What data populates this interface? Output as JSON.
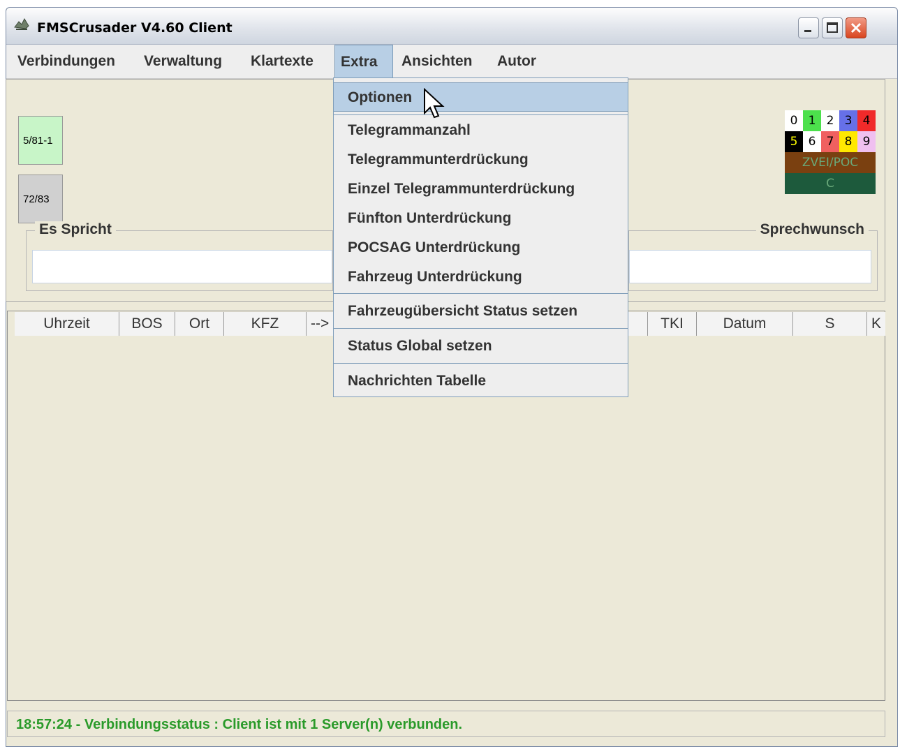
{
  "window": {
    "title": "FMSCrusader V4.60 Client"
  },
  "menubar": {
    "items": [
      {
        "label": "Verbindungen"
      },
      {
        "label": "Verwaltung"
      },
      {
        "label": "Klartexte"
      },
      {
        "label": "Extra"
      },
      {
        "label": "Ansichten"
      },
      {
        "label": "Autor"
      }
    ],
    "active": "Extra"
  },
  "units": [
    {
      "label": "5/81-1",
      "color": "#c8f5c8"
    },
    {
      "label": "72/83",
      "color": "#d0d0d0"
    }
  ],
  "status_legend": {
    "row1": [
      {
        "label": "0",
        "bg": "#ffffff",
        "fg": "#000000"
      },
      {
        "label": "1",
        "bg": "#4ce04c",
        "fg": "#000000"
      },
      {
        "label": "2",
        "bg": "#ffffff",
        "fg": "#000000"
      },
      {
        "label": "3",
        "bg": "#6670e8",
        "fg": "#000000"
      },
      {
        "label": "4",
        "bg": "#f02a2a",
        "fg": "#000000"
      }
    ],
    "row2": [
      {
        "label": "5",
        "bg": "#000000",
        "fg": "#ffff00"
      },
      {
        "label": "6",
        "bg": "#ffffff",
        "fg": "#000000"
      },
      {
        "label": "7",
        "bg": "#f06060",
        "fg": "#000000"
      },
      {
        "label": "8",
        "bg": "#ffe800",
        "fg": "#000000"
      },
      {
        "label": "9",
        "bg": "#f0c0f0",
        "fg": "#000000"
      }
    ],
    "zvei": {
      "label": "ZVEI/POC",
      "bg": "#7a4010"
    },
    "c": {
      "label": "C",
      "bg": "#1d5a3c"
    }
  },
  "groups": {
    "es_spricht": "Es Spricht",
    "sprechwunsch": "Sprechwunsch"
  },
  "table": {
    "columns": [
      "Uhrzeit",
      "BOS",
      "Ort",
      "KFZ",
      "-->",
      "TKI",
      "Datum",
      "S",
      "K"
    ]
  },
  "dropdown": {
    "items": [
      "Optionen",
      "Telegrammanzahl",
      "Telegrammunterdrückung",
      "Einzel Telegrammunterdrückung",
      "Fünfton Unterdrückung",
      "POCSAG Unterdrückung",
      "Fahrzeug Unterdrückung",
      "Fahrzeugübersicht Status setzen",
      "Status Global setzen",
      "Nachrichten Tabelle"
    ],
    "hovered": "Optionen"
  },
  "statusbar": {
    "text": "18:57:24 - Verbindungsstatus : Client ist mit 1 Server(n) verbunden."
  }
}
